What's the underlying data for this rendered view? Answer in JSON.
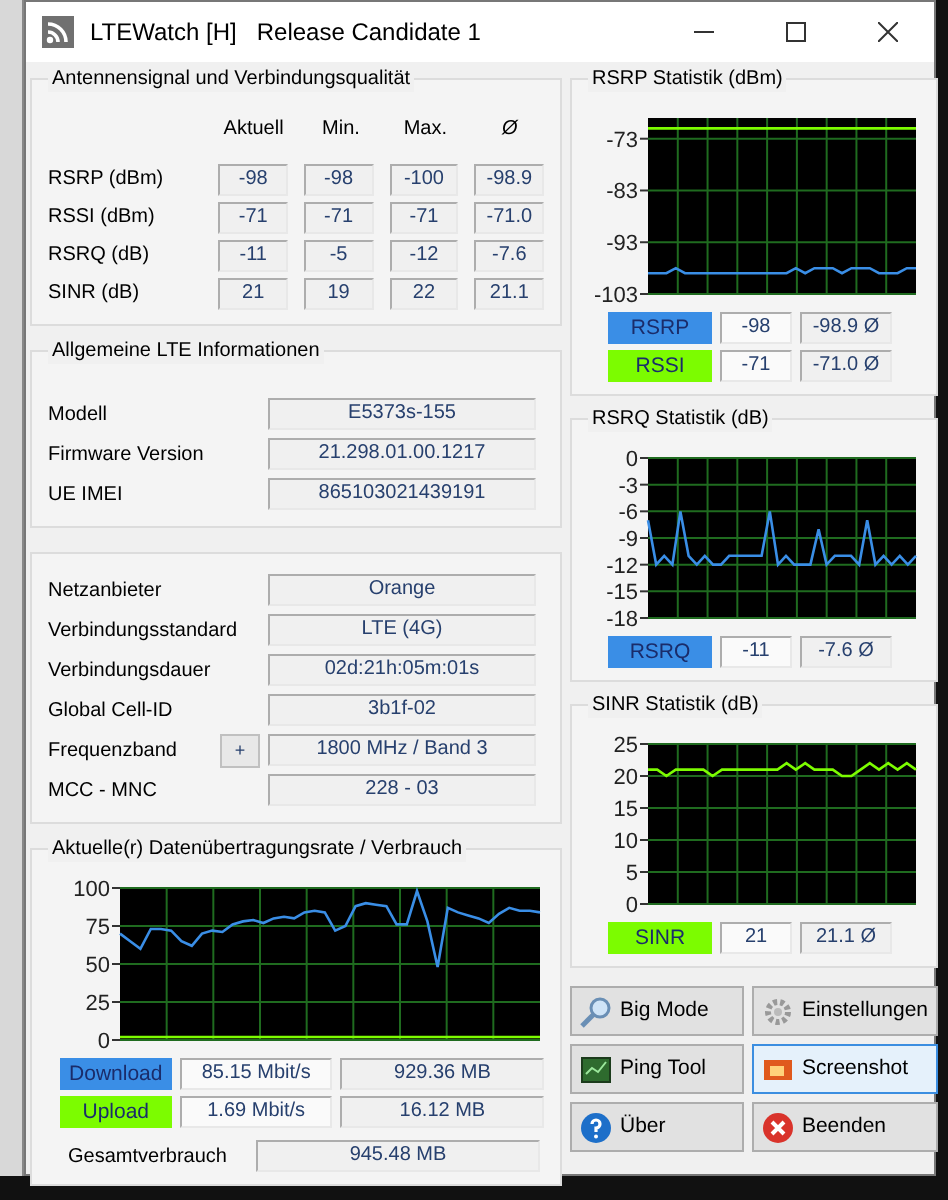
{
  "window": {
    "title": "LTEWatch [H]   Release Candidate 1"
  },
  "signal_quality": {
    "title": "Antennensignal und Verbindungsqualität",
    "columns": [
      "Aktuell",
      "Min.",
      "Max.",
      "Ø"
    ],
    "rows": [
      {
        "label": "RSRP (dBm)",
        "values": [
          "-98",
          "-98",
          "-100",
          "-98.9"
        ]
      },
      {
        "label": "RSSI (dBm)",
        "values": [
          "-71",
          "-71",
          "-71",
          "-71.0"
        ]
      },
      {
        "label": "RSRQ (dB)",
        "values": [
          "-11",
          "-5",
          "-12",
          "-7.6"
        ]
      },
      {
        "label": "SINR (dB)",
        "values": [
          "21",
          "19",
          "22",
          "21.1"
        ]
      }
    ]
  },
  "lte_info": {
    "title": "Allgemeine LTE Informationen",
    "rows": [
      {
        "label": "Modell",
        "value": "E5373s-155"
      },
      {
        "label": "Firmware Version",
        "value": "21.298.01.00.1217"
      },
      {
        "label": "UE IMEI",
        "value": "865103021439191"
      }
    ]
  },
  "network": {
    "rows": [
      {
        "label": "Netzanbieter",
        "value": "Orange"
      },
      {
        "label": "Verbindungsstandard",
        "value": "LTE (4G)"
      },
      {
        "label": "Verbindungsdauer",
        "value": "02d:21h:05m:01s"
      },
      {
        "label": "Global Cell-ID",
        "value": "3b1f-02"
      },
      {
        "label": "Frequenzband",
        "value": "1800 MHz / Band 3",
        "button": "+"
      },
      {
        "label": "MCC - MNC",
        "value": "228 - 03"
      }
    ]
  },
  "data_rate": {
    "title": "Aktuelle(r) Datenübertragungsrate / Verbrauch",
    "chart_data": {
      "type": "line",
      "grid": true,
      "ylim": [
        0,
        100
      ],
      "yticks": [
        0,
        25,
        50,
        75,
        100
      ],
      "series": [
        {
          "name": "Download",
          "color": "#3a8ee6",
          "values": [
            70,
            65,
            60,
            73,
            73,
            72,
            65,
            62,
            70,
            72,
            71,
            76,
            78,
            79,
            77,
            80,
            81,
            80,
            84,
            85,
            84,
            72,
            75,
            88,
            90,
            89,
            88,
            76,
            76,
            98,
            78,
            48,
            87,
            84,
            82,
            80,
            77,
            83,
            87,
            85,
            85,
            84
          ]
        },
        {
          "name": "Upload",
          "color": "#7cfc00",
          "values": [
            2,
            2,
            2,
            2,
            2,
            2,
            2,
            2,
            2,
            2,
            2,
            2,
            2,
            2,
            2,
            2,
            2,
            2,
            2,
            2,
            2,
            2,
            2,
            2,
            2,
            2,
            2,
            2,
            2,
            2,
            2,
            2,
            2,
            2,
            2,
            2,
            2,
            2,
            2,
            2,
            2,
            2
          ]
        }
      ]
    },
    "rows": [
      {
        "rate": "85.15 Mbit/s",
        "total": "929.36 MB"
      },
      {
        "rate": "1.69 Mbit/s",
        "total": "16.12 MB"
      }
    ],
    "total": {
      "label": "Gesamtverbrauch",
      "value": "945.48 MB"
    }
  },
  "rsrp_stats": {
    "title": "RSRP Statistik (dBm)",
    "chart_data": {
      "type": "line",
      "grid": true,
      "ylim": [
        -103,
        -69
      ],
      "yticks": [
        -103,
        -93,
        -83,
        -73
      ],
      "series": [
        {
          "name": "RSRP",
          "color": "#3a8ee6",
          "values": [
            -99,
            -99,
            -99,
            -98,
            -99,
            -99,
            -99,
            -99,
            -99,
            -99,
            -99,
            -99,
            -99,
            -99,
            -99,
            -99,
            -98,
            -99,
            -98,
            -98,
            -98,
            -99,
            -98,
            -98,
            -98,
            -99,
            -99,
            -99,
            -98,
            -98
          ]
        },
        {
          "name": "RSSI",
          "color": "#7cfc00",
          "values": [
            -71,
            -71,
            -71,
            -71,
            -71,
            -71,
            -71,
            -71,
            -71,
            -71,
            -71,
            -71,
            -71,
            -71,
            -71,
            -71,
            -71,
            -71,
            -71,
            -71,
            -71,
            -71,
            -71,
            -71,
            -71,
            -71,
            -71,
            -71,
            -71,
            -71
          ]
        }
      ]
    },
    "legend": [
      {
        "current": "-98",
        "average": "-98.9 Ø"
      },
      {
        "current": "-71",
        "average": "-71.0 Ø"
      }
    ]
  },
  "rsrq_stats": {
    "title": "RSRQ Statistik (dB)",
    "chart_data": {
      "type": "line",
      "grid": true,
      "ylim": [
        -18,
        0
      ],
      "yticks": [
        -18,
        -15,
        -12,
        -9,
        -6,
        -3,
        0
      ],
      "series": [
        {
          "name": "RSRQ",
          "color": "#3a8ee6",
          "values": [
            -7,
            -12,
            -11,
            -12,
            -6,
            -11,
            -12,
            -11,
            -12,
            -12,
            -11,
            -11,
            -11,
            -11,
            -11,
            -6,
            -12,
            -11,
            -12,
            -12,
            -12,
            -8,
            -12,
            -11,
            -11,
            -11,
            -12,
            -7,
            -12,
            -11,
            -12,
            -11,
            -12,
            -11
          ]
        }
      ]
    },
    "legend": [
      {
        "current": "-11",
        "average": "-7.6 Ø"
      }
    ]
  },
  "sinr_stats": {
    "title": "SINR Statistik (dB)",
    "chart_data": {
      "type": "line",
      "grid": true,
      "ylim": [
        0,
        25
      ],
      "yticks": [
        0,
        5,
        10,
        15,
        20,
        25
      ],
      "series": [
        {
          "name": "SINR",
          "color": "#7cfc00",
          "values": [
            21,
            21,
            20,
            21,
            21,
            21,
            21,
            20,
            21,
            21,
            21,
            21,
            21,
            21,
            21,
            22,
            21,
            22,
            21,
            21,
            21,
            20,
            20,
            21,
            22,
            21,
            22,
            21,
            22,
            21
          ]
        }
      ]
    },
    "legend": [
      {
        "current": "21",
        "average": "21.1 Ø"
      }
    ]
  },
  "buttons": [
    {
      "label": "Big Mode",
      "kind": "zoom",
      "focused": false
    },
    {
      "label": "Einstellungen",
      "kind": "settings",
      "focused": false
    },
    {
      "label": "Ping Tool",
      "kind": "ping",
      "focused": false
    },
    {
      "label": "Screenshot",
      "kind": "screenshot",
      "focused": true
    },
    {
      "label": "Über",
      "kind": "about",
      "focused": false
    },
    {
      "label": "Beenden",
      "kind": "exit",
      "focused": false
    }
  ]
}
